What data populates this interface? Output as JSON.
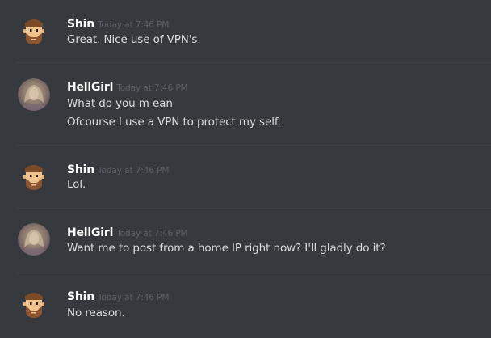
{
  "messages": [
    {
      "author": "Shin",
      "timestamp": "Today at 7:46 PM",
      "avatar_icon": "bearded-man-avatar-icon",
      "lines": [
        "Great. Nice use of VPN's."
      ]
    },
    {
      "author": "HellGirl",
      "timestamp": "Today at 7:46 PM",
      "avatar_icon": "photo-avatar-icon",
      "lines": [
        "What do you m ean",
        "Ofcourse I use a VPN to protect my self."
      ]
    },
    {
      "author": "Shin",
      "timestamp": "Today at 7:46 PM",
      "avatar_icon": "bearded-man-avatar-icon",
      "lines": [
        "Lol."
      ]
    },
    {
      "author": "HellGirl",
      "timestamp": "Today at 7:46 PM",
      "avatar_icon": "photo-avatar-icon",
      "lines": [
        "Want me to post from a home IP right now? I'll gladly do it?"
      ]
    },
    {
      "author": "Shin",
      "timestamp": "Today at 7:46 PM",
      "avatar_icon": "bearded-man-avatar-icon",
      "lines": [
        "No reason."
      ]
    }
  ],
  "colors": {
    "background": "#36393e",
    "username": "#ffffff",
    "message_text": "#dcddde",
    "timestamp": "#5d6066",
    "divider": "#3e4147"
  }
}
